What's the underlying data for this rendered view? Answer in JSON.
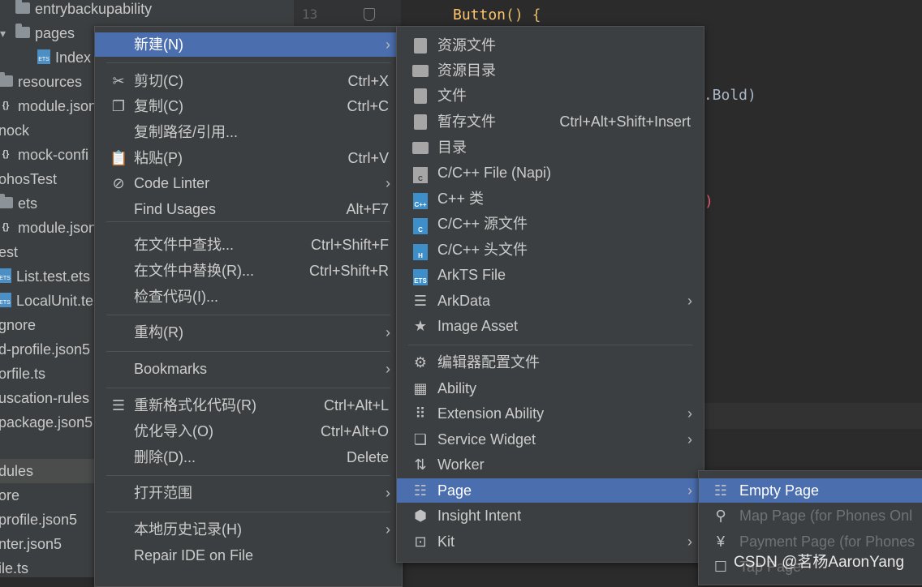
{
  "tree": {
    "items": [
      {
        "label": "entrybackupability",
        "icon": "folder-icon"
      },
      {
        "label": "pages",
        "icon": "folder-icon"
      },
      {
        "label": "Index",
        "icon": "ets-file-icon"
      },
      {
        "label": "resources",
        "icon": "folder-icon"
      },
      {
        "label": "module.json",
        "icon": "json-file-icon"
      },
      {
        "label": "nock",
        "icon": "none"
      },
      {
        "label": "mock-confi",
        "icon": "json-file-icon"
      },
      {
        "label": "ohosTest",
        "icon": "none"
      },
      {
        "label": "ets",
        "icon": "folder-icon"
      },
      {
        "label": "module.json",
        "icon": "json-file-icon"
      },
      {
        "label": "est",
        "icon": "none"
      },
      {
        "label": "List.test.ets",
        "icon": "ets-file-icon"
      },
      {
        "label": "LocalUnit.te",
        "icon": "ets-file-icon"
      },
      {
        "label": "gnore",
        "icon": "none"
      },
      {
        "label": "d-profile.json5",
        "icon": "none"
      },
      {
        "label": "orfile.ts",
        "icon": "none"
      },
      {
        "label": "uscation-rules",
        "icon": "none"
      },
      {
        "label": "package.json5",
        "icon": "none"
      },
      {
        "label": "",
        "icon": "none"
      },
      {
        "label": "dules",
        "icon": "none"
      },
      {
        "label": "ore",
        "icon": "none"
      },
      {
        "label": "profile.json5",
        "icon": "none"
      },
      {
        "label": "nter.json5",
        "icon": "none"
      },
      {
        "label": "ile.ts",
        "icon": "none"
      }
    ]
  },
  "editor": {
    "line_number": "13",
    "code_button": "Button",
    "code_parens": "()",
    "code_brace": "{",
    "code_bold": "t.Bold)",
    "code_paren": ")"
  },
  "menu1": {
    "items": [
      {
        "label": "新建(N)",
        "shortcut": "",
        "icon": "",
        "submenu": true,
        "selected": true
      },
      {
        "label": "剪切(C)",
        "shortcut": "Ctrl+X",
        "icon": "scissors-icon"
      },
      {
        "label": "复制(C)",
        "shortcut": "Ctrl+C",
        "icon": "copy-icon"
      },
      {
        "label": "复制路径/引用...",
        "shortcut": "",
        "icon": ""
      },
      {
        "label": "粘贴(P)",
        "shortcut": "Ctrl+V",
        "icon": "paste-icon"
      },
      {
        "label": "Code Linter",
        "shortcut": "",
        "icon": "code-linter-icon",
        "submenu": true
      },
      {
        "label": "Find Usages",
        "shortcut": "Alt+F7",
        "icon": ""
      },
      {
        "label": "在文件中查找...",
        "shortcut": "Ctrl+Shift+F",
        "icon": ""
      },
      {
        "label": "在文件中替换(R)...",
        "shortcut": "Ctrl+Shift+R",
        "icon": ""
      },
      {
        "label": "检查代码(I)...",
        "shortcut": "",
        "icon": ""
      },
      {
        "label": "重构(R)",
        "shortcut": "",
        "icon": "",
        "submenu": true
      },
      {
        "label": "Bookmarks",
        "shortcut": "",
        "icon": "",
        "submenu": true
      },
      {
        "label": "重新格式化代码(R)",
        "shortcut": "Ctrl+Alt+L",
        "icon": "reformat-icon"
      },
      {
        "label": "优化导入(O)",
        "shortcut": "Ctrl+Alt+O",
        "icon": ""
      },
      {
        "label": "删除(D)...",
        "shortcut": "Delete",
        "icon": ""
      },
      {
        "label": "打开范围",
        "shortcut": "",
        "icon": "",
        "submenu": true
      },
      {
        "label": "本地历史记录(H)",
        "shortcut": "",
        "icon": "",
        "submenu": true
      },
      {
        "label": "Repair IDE on File",
        "shortcut": "",
        "icon": ""
      }
    ]
  },
  "menu2": {
    "items": [
      {
        "label": "资源文件",
        "shortcut": "",
        "icon": "resource-file-icon"
      },
      {
        "label": "资源目录",
        "shortcut": "",
        "icon": "resource-dir-icon"
      },
      {
        "label": "文件",
        "shortcut": "",
        "icon": "file-icon"
      },
      {
        "label": "暂存文件",
        "shortcut": "Ctrl+Alt+Shift+Insert",
        "icon": "scratch-file-icon"
      },
      {
        "label": "目录",
        "shortcut": "",
        "icon": "directory-icon"
      },
      {
        "label": "C/C++ File (Napi)",
        "shortcut": "",
        "icon": "c-napi-icon"
      },
      {
        "label": "C++ 类",
        "shortcut": "",
        "icon": "cpp-class-icon"
      },
      {
        "label": "C/C++ 源文件",
        "shortcut": "",
        "icon": "c-source-icon"
      },
      {
        "label": "C/C++ 头文件",
        "shortcut": "",
        "icon": "c-header-icon"
      },
      {
        "label": "ArkTS File",
        "shortcut": "",
        "icon": "arkts-file-icon"
      },
      {
        "label": "ArkData",
        "shortcut": "",
        "icon": "database-icon",
        "submenu": true
      },
      {
        "label": "Image Asset",
        "shortcut": "",
        "icon": "image-asset-icon"
      },
      {
        "label": "编辑器配置文件",
        "shortcut": "",
        "icon": "gear-icon"
      },
      {
        "label": "Ability",
        "shortcut": "",
        "icon": "ability-icon"
      },
      {
        "label": "Extension Ability",
        "shortcut": "",
        "icon": "grid-icon",
        "submenu": true
      },
      {
        "label": "Service Widget",
        "shortcut": "",
        "icon": "widget-icon",
        "submenu": true
      },
      {
        "label": "Worker",
        "shortcut": "",
        "icon": "worker-icon"
      },
      {
        "label": "Page",
        "shortcut": "",
        "icon": "list-icon",
        "submenu": true,
        "selected": true
      },
      {
        "label": "Insight Intent",
        "shortcut": "",
        "icon": "cube-icon"
      },
      {
        "label": "Kit",
        "shortcut": "",
        "icon": "kit-icon",
        "submenu": true
      }
    ]
  },
  "menu3": {
    "items": [
      {
        "label": "Empty Page",
        "icon": "list-icon",
        "selected": true
      },
      {
        "label": "Map Page (for Phones Onl",
        "icon": "map-pin-icon",
        "disabled": true
      },
      {
        "label": "Payment Page (for Phones",
        "icon": "payment-icon",
        "disabled": true
      },
      {
        "label": "Tap Page",
        "icon": "tap-icon",
        "disabled": true
      }
    ]
  },
  "watermark": "CSDN @茗杨AaronYang"
}
